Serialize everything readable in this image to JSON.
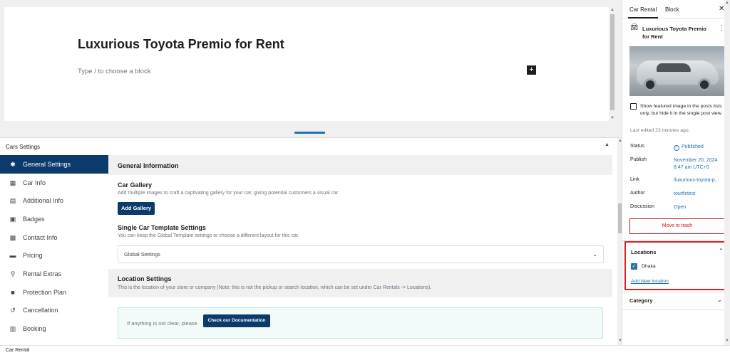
{
  "editor": {
    "title": "Luxurious Toyota Premio for Rent",
    "block_placeholder": "Type / to choose a block",
    "add_block_glyph": "+"
  },
  "metabox": {
    "title": "Cars Settings",
    "toggle_glyph": "▲",
    "nav": [
      {
        "label": "General Settings",
        "icon": "gear-icon",
        "glyph": "✱",
        "active": true
      },
      {
        "label": "Car Info",
        "icon": "calendar-icon",
        "glyph": "▦",
        "active": false
      },
      {
        "label": "Additional Info",
        "icon": "document-icon",
        "glyph": "▤",
        "active": false
      },
      {
        "label": "Badges",
        "icon": "badge-icon",
        "glyph": "▣",
        "active": false
      },
      {
        "label": "Contact Info",
        "icon": "contact-card-icon",
        "glyph": "▩",
        "active": false
      },
      {
        "label": "Pricing",
        "icon": "credit-card-icon",
        "glyph": "▬",
        "active": false
      },
      {
        "label": "Rental Extras",
        "icon": "share-icon",
        "glyph": "⚲",
        "active": false
      },
      {
        "label": "Protection Plan",
        "icon": "lock-icon",
        "glyph": "■",
        "active": false
      },
      {
        "label": "Cancellation",
        "icon": "undo-icon",
        "glyph": "↺",
        "active": false
      },
      {
        "label": "Booking",
        "icon": "booking-icon",
        "glyph": "▥",
        "active": false
      }
    ],
    "general_information": {
      "heading": "General Information",
      "gallery_title": "Car Gallery",
      "gallery_desc": "Add multiple images to craft a captivating gallery for your car, giving potential customers a visual car.",
      "add_gallery_label": "Add Gallery",
      "template_title": "Single Car Template Settings",
      "template_desc": "You can keep the Global Template settings or choose a different layout for this car.",
      "template_selected": "Global Settings"
    },
    "location_settings": {
      "heading": "Location Settings",
      "desc": "This is the location of your store or company (Note: this is not the pickup or search location, which can be set under Car Rentals -> Locations)."
    },
    "doc_box": {
      "text": "If anything is not clear, please",
      "button_label": "Check our Documentation"
    }
  },
  "sidebar": {
    "tabs": [
      {
        "label": "Car Rental",
        "active": true
      },
      {
        "label": "Block",
        "active": false
      }
    ],
    "close_glyph": "✕",
    "post_title": "Luxurious Toyota Premio for Rent",
    "more_glyph": "⋮",
    "featured_checkbox_label": "Show featured image in the posts lists only, but hide it in the single post view.",
    "last_edited": "Last edited 23 minutes ago.",
    "rows": {
      "status_label": "Status",
      "status_value": "Published",
      "publish_label": "Publish",
      "publish_value": "November 20, 2024 8:47 am UTC+0",
      "link_label": "Link",
      "link_value": "/luxurious-toyota-p...",
      "author_label": "Author",
      "author_value": "tourfictest",
      "discussion_label": "Discussion",
      "discussion_value": "Open"
    },
    "trash_label": "Move to trash",
    "locations": {
      "title": "Locations",
      "items": [
        {
          "label": "Dhaka",
          "checked": true
        }
      ],
      "add_new_label": "Add New location"
    },
    "category": {
      "title": "Category"
    }
  },
  "footer": {
    "breadcrumb": "Car Rental"
  },
  "colors": {
    "accent": "#0a3b6b",
    "link": "#2271b1",
    "danger": "#cc1818",
    "highlight_border": "#e02020"
  }
}
